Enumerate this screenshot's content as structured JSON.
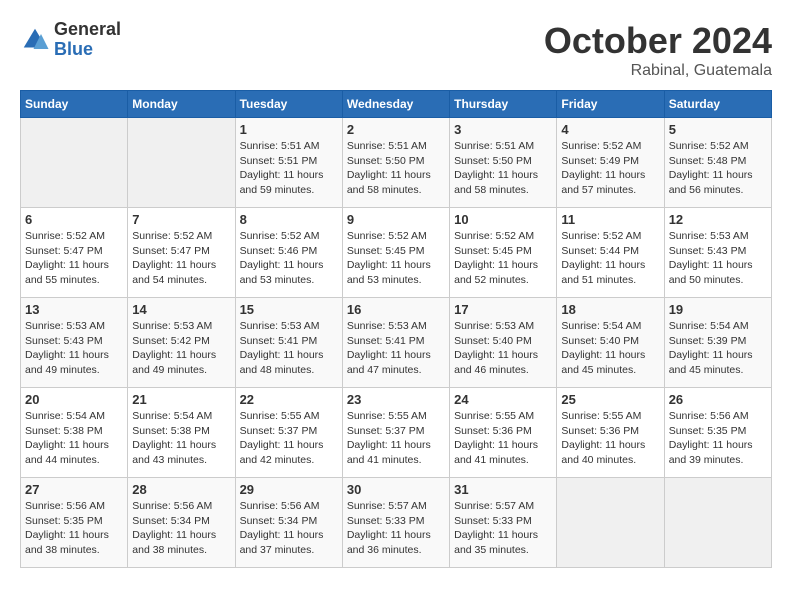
{
  "logo": {
    "general": "General",
    "blue": "Blue"
  },
  "title": "October 2024",
  "location": "Rabinal, Guatemala",
  "days_header": [
    "Sunday",
    "Monday",
    "Tuesday",
    "Wednesday",
    "Thursday",
    "Friday",
    "Saturday"
  ],
  "weeks": [
    [
      {
        "day": "",
        "info": ""
      },
      {
        "day": "",
        "info": ""
      },
      {
        "day": "1",
        "info": "Sunrise: 5:51 AM\nSunset: 5:51 PM\nDaylight: 11 hours and 59 minutes."
      },
      {
        "day": "2",
        "info": "Sunrise: 5:51 AM\nSunset: 5:50 PM\nDaylight: 11 hours and 58 minutes."
      },
      {
        "day": "3",
        "info": "Sunrise: 5:51 AM\nSunset: 5:50 PM\nDaylight: 11 hours and 58 minutes."
      },
      {
        "day": "4",
        "info": "Sunrise: 5:52 AM\nSunset: 5:49 PM\nDaylight: 11 hours and 57 minutes."
      },
      {
        "day": "5",
        "info": "Sunrise: 5:52 AM\nSunset: 5:48 PM\nDaylight: 11 hours and 56 minutes."
      }
    ],
    [
      {
        "day": "6",
        "info": "Sunrise: 5:52 AM\nSunset: 5:47 PM\nDaylight: 11 hours and 55 minutes."
      },
      {
        "day": "7",
        "info": "Sunrise: 5:52 AM\nSunset: 5:47 PM\nDaylight: 11 hours and 54 minutes."
      },
      {
        "day": "8",
        "info": "Sunrise: 5:52 AM\nSunset: 5:46 PM\nDaylight: 11 hours and 53 minutes."
      },
      {
        "day": "9",
        "info": "Sunrise: 5:52 AM\nSunset: 5:45 PM\nDaylight: 11 hours and 53 minutes."
      },
      {
        "day": "10",
        "info": "Sunrise: 5:52 AM\nSunset: 5:45 PM\nDaylight: 11 hours and 52 minutes."
      },
      {
        "day": "11",
        "info": "Sunrise: 5:52 AM\nSunset: 5:44 PM\nDaylight: 11 hours and 51 minutes."
      },
      {
        "day": "12",
        "info": "Sunrise: 5:53 AM\nSunset: 5:43 PM\nDaylight: 11 hours and 50 minutes."
      }
    ],
    [
      {
        "day": "13",
        "info": "Sunrise: 5:53 AM\nSunset: 5:43 PM\nDaylight: 11 hours and 49 minutes."
      },
      {
        "day": "14",
        "info": "Sunrise: 5:53 AM\nSunset: 5:42 PM\nDaylight: 11 hours and 49 minutes."
      },
      {
        "day": "15",
        "info": "Sunrise: 5:53 AM\nSunset: 5:41 PM\nDaylight: 11 hours and 48 minutes."
      },
      {
        "day": "16",
        "info": "Sunrise: 5:53 AM\nSunset: 5:41 PM\nDaylight: 11 hours and 47 minutes."
      },
      {
        "day": "17",
        "info": "Sunrise: 5:53 AM\nSunset: 5:40 PM\nDaylight: 11 hours and 46 minutes."
      },
      {
        "day": "18",
        "info": "Sunrise: 5:54 AM\nSunset: 5:40 PM\nDaylight: 11 hours and 45 minutes."
      },
      {
        "day": "19",
        "info": "Sunrise: 5:54 AM\nSunset: 5:39 PM\nDaylight: 11 hours and 45 minutes."
      }
    ],
    [
      {
        "day": "20",
        "info": "Sunrise: 5:54 AM\nSunset: 5:38 PM\nDaylight: 11 hours and 44 minutes."
      },
      {
        "day": "21",
        "info": "Sunrise: 5:54 AM\nSunset: 5:38 PM\nDaylight: 11 hours and 43 minutes."
      },
      {
        "day": "22",
        "info": "Sunrise: 5:55 AM\nSunset: 5:37 PM\nDaylight: 11 hours and 42 minutes."
      },
      {
        "day": "23",
        "info": "Sunrise: 5:55 AM\nSunset: 5:37 PM\nDaylight: 11 hours and 41 minutes."
      },
      {
        "day": "24",
        "info": "Sunrise: 5:55 AM\nSunset: 5:36 PM\nDaylight: 11 hours and 41 minutes."
      },
      {
        "day": "25",
        "info": "Sunrise: 5:55 AM\nSunset: 5:36 PM\nDaylight: 11 hours and 40 minutes."
      },
      {
        "day": "26",
        "info": "Sunrise: 5:56 AM\nSunset: 5:35 PM\nDaylight: 11 hours and 39 minutes."
      }
    ],
    [
      {
        "day": "27",
        "info": "Sunrise: 5:56 AM\nSunset: 5:35 PM\nDaylight: 11 hours and 38 minutes."
      },
      {
        "day": "28",
        "info": "Sunrise: 5:56 AM\nSunset: 5:34 PM\nDaylight: 11 hours and 38 minutes."
      },
      {
        "day": "29",
        "info": "Sunrise: 5:56 AM\nSunset: 5:34 PM\nDaylight: 11 hours and 37 minutes."
      },
      {
        "day": "30",
        "info": "Sunrise: 5:57 AM\nSunset: 5:33 PM\nDaylight: 11 hours and 36 minutes."
      },
      {
        "day": "31",
        "info": "Sunrise: 5:57 AM\nSunset: 5:33 PM\nDaylight: 11 hours and 35 minutes."
      },
      {
        "day": "",
        "info": ""
      },
      {
        "day": "",
        "info": ""
      }
    ]
  ]
}
